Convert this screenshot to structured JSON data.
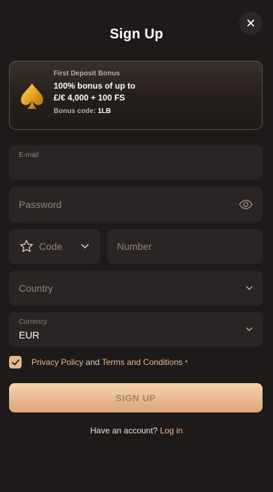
{
  "header": {
    "title": "Sign Up"
  },
  "bonus": {
    "subtitle": "First Deposit Bonus",
    "line1": "100% bonus of up to",
    "line2": "£/€ 4,000 + 100 FS",
    "code_label": "Bonus code:",
    "code_value": "1LB"
  },
  "form": {
    "email_label": "E-mail",
    "password_placeholder": "Password",
    "code_placeholder": "Code",
    "number_placeholder": "Number",
    "country_placeholder": "Country",
    "currency_label": "Currency",
    "currency_value": "EUR"
  },
  "terms": {
    "privacy": "Privacy Policy",
    "and": "and",
    "conditions": "Terms and Conditions",
    "required_mark": "*",
    "checked": true
  },
  "actions": {
    "signup_label": "SIGN UP",
    "have_account": "Have an account?",
    "login_label": "Log in"
  },
  "colors": {
    "background": "#1e1a19",
    "field": "#2a2524",
    "accent": "#e9b68a"
  }
}
